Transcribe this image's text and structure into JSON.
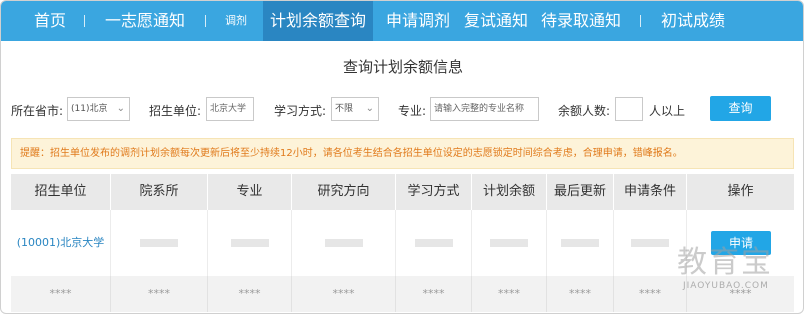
{
  "nav": {
    "items": [
      {
        "label": "首页"
      },
      {
        "label": "一志愿通知"
      },
      {
        "label": "调剂"
      },
      {
        "label": "计划余额查询"
      },
      {
        "label": "申请调剂"
      },
      {
        "label": "复试通知"
      },
      {
        "label": "待录取通知"
      },
      {
        "label": "初试成绩"
      }
    ],
    "active_index": 3
  },
  "page_title": "查询计划余额信息",
  "filters": {
    "province_label": "所在省市:",
    "province_value": "(11)北京",
    "school_label": "招生单位:",
    "school_value": "北京大学",
    "study_mode_label": "学习方式:",
    "study_mode_value": "不限",
    "major_label": "专业:",
    "major_placeholder": "请输入完整的专业名称",
    "quota_label": "余额人数:",
    "quota_value": "",
    "quota_suffix": "人以上",
    "query_button": "查询"
  },
  "notice": "提醒：招生单位发布的调剂计划余额每次更新后将至少持续12小时，请各位考生结合各招生单位设定的志愿锁定时间综合考虑，合理申请，错峰报名。",
  "table": {
    "headers": [
      "招生单位",
      "院系所",
      "专业",
      "研究方向",
      "学习方式",
      "计划余额",
      "最后更新",
      "申请条件",
      "操作"
    ],
    "row1": {
      "school": "(10001)北京大学",
      "action": "申请"
    },
    "row2": [
      "****",
      "****",
      "****",
      "****",
      "****",
      "****",
      "****",
      "****",
      "****"
    ]
  },
  "watermark": {
    "cn": "教育宝",
    "en": "JIAOYUBAO.COM"
  },
  "colors": {
    "nav_bg": "#3aa6e0",
    "nav_active": "#2a86c2",
    "button": "#22a6e6",
    "notice_text": "#e07a1b",
    "notice_bg": "#fdf3d9"
  }
}
